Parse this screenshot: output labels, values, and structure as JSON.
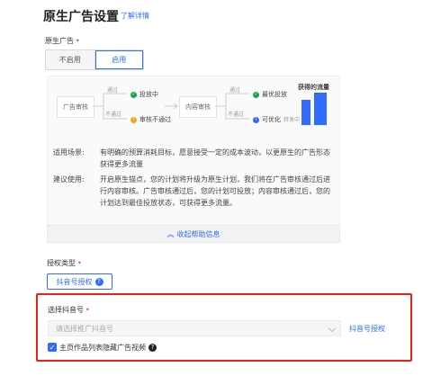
{
  "header": {
    "title": "原生广告设置",
    "learn_more": "了解详情"
  },
  "native_ad": {
    "label": "原生广告",
    "options": [
      "不启用",
      "启用"
    ],
    "selected": "启用"
  },
  "diagram": {
    "left_box": "广告审核",
    "left_branch_top": "通过",
    "left_branch_bottom": "不通过",
    "left_result_ok": "投放中",
    "left_result_fail": "审核不通过",
    "mid_box": "内容审核",
    "right_branch_top": "通过",
    "right_branch_bottom": "不通过",
    "right_result_ok": "最优投放",
    "right_result_fix": "可优化",
    "right_note": "转发中",
    "chart_title": "获得的流量"
  },
  "info": {
    "scene_label": "适用场景:",
    "scene_text": "有明确的预算消耗目标，愿意接受一定的成本波动，以更原生的广告形态获得更多流量",
    "advice_label": "建议使用:",
    "advice_text": "开启原生锚点，您的计划将升级为原生计划，我们将在广告审核通过后进行内容审核。广告审核通过后，您的计划可投放；内容审核通过后，您的计划达到最佳投放状态，可获得更多流量。"
  },
  "collapse": {
    "label": "收起帮助信息",
    "icon": "double-chevron-up-icon"
  },
  "auth_type": {
    "label": "授权类型",
    "button": "抖音号授权",
    "help_icon": "question-circle-icon"
  },
  "douyin": {
    "label": "选择抖音号",
    "placeholder": "请选择推广抖音号",
    "link": "抖音号授权",
    "checkbox_label": "主页作品列表隐藏广告视频",
    "checkbox_checked": true
  },
  "colors": {
    "accent": "#2f6bff",
    "danger": "#e8211a",
    "success": "#1aa34a",
    "warn": "#f5a623"
  }
}
